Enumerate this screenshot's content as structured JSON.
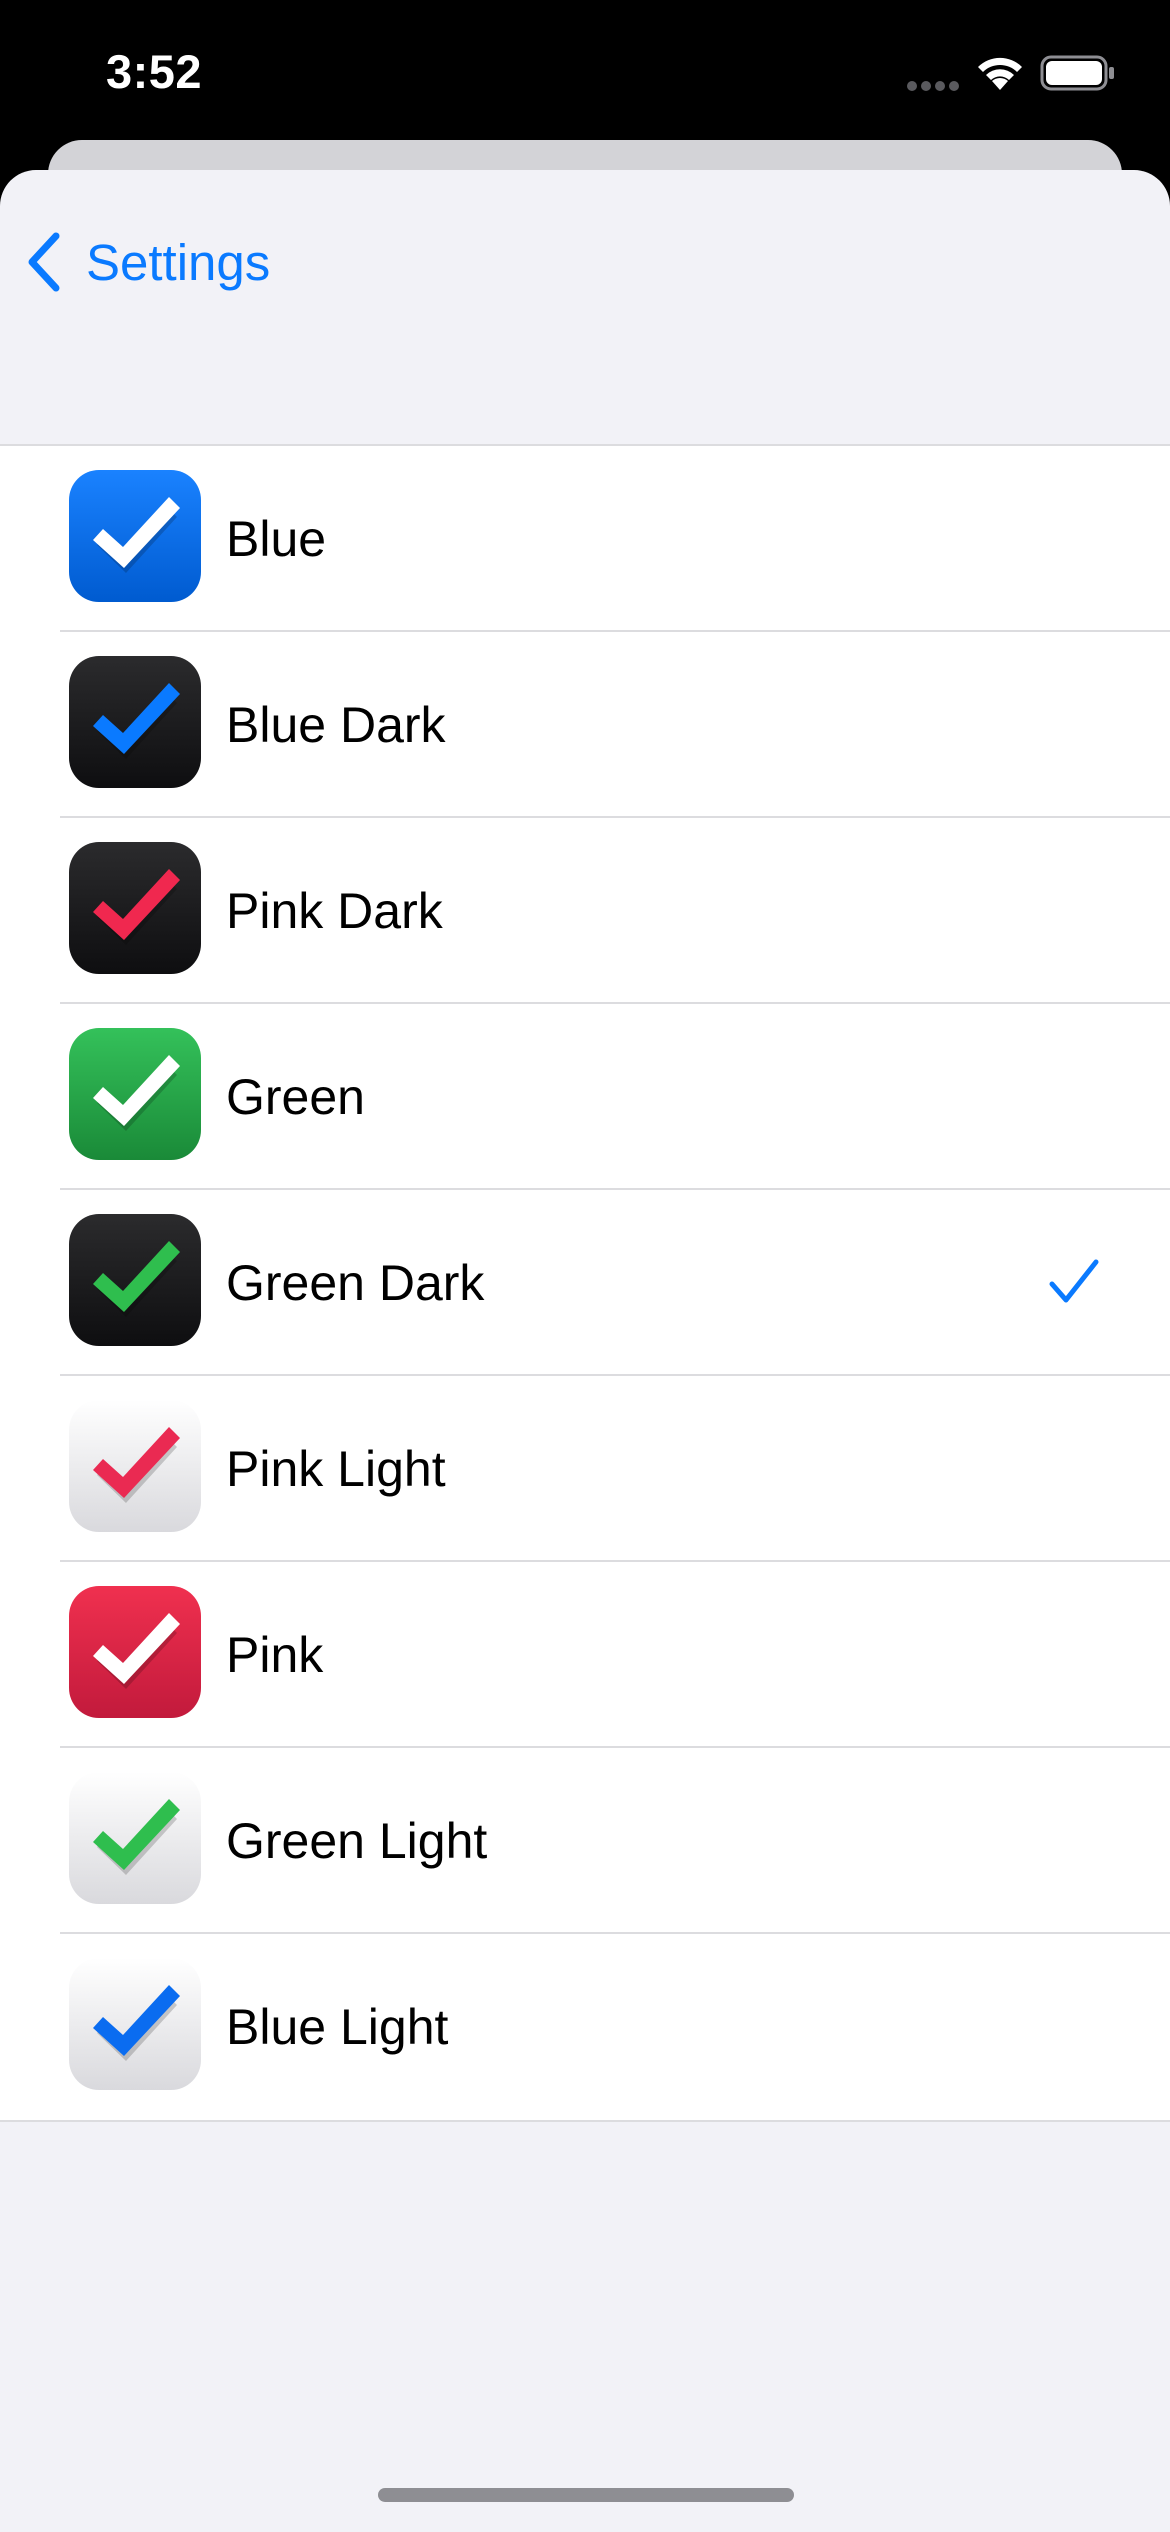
{
  "status_bar": {
    "time": "3:52",
    "icons": [
      "signal-dots-icon",
      "wifi-icon",
      "battery-icon"
    ]
  },
  "nav": {
    "back_label": "Settings",
    "back_icon": "chevron-left-icon",
    "accent_color": "#0a7aff"
  },
  "list": {
    "items": [
      {
        "label": "Blue",
        "icon": "checkmark-app-icon",
        "bg_top": "#1a82ff",
        "bg_bottom": "#005bd0",
        "check_color": "#ffffff",
        "selected": false
      },
      {
        "label": "Blue Dark",
        "icon": "checkmark-app-icon",
        "bg_top": "#2b2b2d",
        "bg_bottom": "#0e0e10",
        "check_color": "#0a7aff",
        "selected": false
      },
      {
        "label": "Pink Dark",
        "icon": "checkmark-app-icon",
        "bg_top": "#2b2b2d",
        "bg_bottom": "#0e0e10",
        "check_color": "#f0284f",
        "selected": false
      },
      {
        "label": "Green",
        "icon": "checkmark-app-icon",
        "bg_top": "#34c15a",
        "bg_bottom": "#1a8a38",
        "check_color": "#ffffff",
        "selected": false
      },
      {
        "label": "Green Dark",
        "icon": "checkmark-app-icon",
        "bg_top": "#2b2b2d",
        "bg_bottom": "#0e0e10",
        "check_color": "#2fbe4e",
        "selected": true
      },
      {
        "label": "Pink Light",
        "icon": "checkmark-app-icon",
        "bg_top": "#ffffff",
        "bg_bottom": "#d9d9dd",
        "check_color": "#ea2a52",
        "selected": false
      },
      {
        "label": "Pink",
        "icon": "checkmark-app-icon",
        "bg_top": "#f0304f",
        "bg_bottom": "#c21a3c",
        "check_color": "#ffffff",
        "selected": false
      },
      {
        "label": "Green Light",
        "icon": "checkmark-app-icon",
        "bg_top": "#ffffff",
        "bg_bottom": "#d9d9dd",
        "check_color": "#2fbe4e",
        "selected": false
      },
      {
        "label": "Blue Light",
        "icon": "checkmark-app-icon",
        "bg_top": "#ffffff",
        "bg_bottom": "#d9d9dd",
        "check_color": "#0a6cf0",
        "selected": false
      }
    ],
    "selected_indicator_icon": "checkmark-icon",
    "selected_indicator_color": "#0a7aff"
  }
}
